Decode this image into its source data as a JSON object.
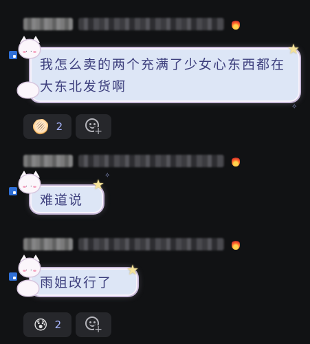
{
  "messages": [
    {
      "text": "我怎么卖的两个充满了少女心东西都在大东北发货啊",
      "reactions": [
        {
          "emoji": "🫓",
          "count": "2"
        },
        {
          "add_label": "add-reaction"
        }
      ]
    },
    {
      "text": "难道说",
      "reactions": []
    },
    {
      "text": "雨姐改行了",
      "reactions": [
        {
          "emoji": "😰",
          "count": "2"
        },
        {
          "add_label": "add-reaction"
        }
      ]
    }
  ],
  "colors": {
    "background": "#111214",
    "bubble": "#dde6f6",
    "bubble_text": "#3d3f7d",
    "reaction_bg": "#26272b",
    "count": "#a9b6ff",
    "fire_badge": "#d8322a"
  },
  "icons": {
    "badge": "fire-icon",
    "add_reaction": "add-emoji-icon",
    "bubble_deco": "cat-sticker-icon",
    "star": "star-icon"
  }
}
